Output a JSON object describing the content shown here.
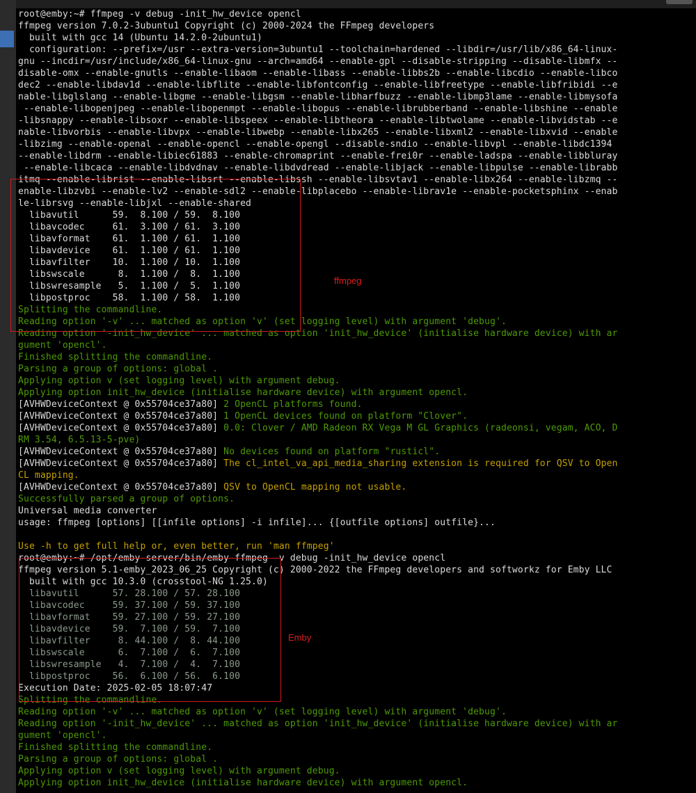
{
  "lines": [
    {
      "c": "w",
      "t": "root@emby:~# ffmpeg -v debug -init_hw_device opencl"
    },
    {
      "c": "w",
      "t": "ffmpeg version 7.0.2-3ubuntu1 Copyright (c) 2000-2024 the FFmpeg developers"
    },
    {
      "c": "w",
      "t": "  built with gcc 14 (Ubuntu 14.2.0-2ubuntu1)"
    },
    {
      "c": "w",
      "t": "  configuration: --prefix=/usr --extra-version=3ubuntu1 --toolchain=hardened --libdir=/usr/lib/x86_64-linux-"
    },
    {
      "c": "w",
      "t": "gnu --incdir=/usr/include/x86_64-linux-gnu --arch=amd64 --enable-gpl --disable-stripping --disable-libmfx --"
    },
    {
      "c": "w",
      "t": "disable-omx --enable-gnutls --enable-libaom --enable-libass --enable-libbs2b --enable-libcdio --enable-libco"
    },
    {
      "c": "w",
      "t": "dec2 --enable-libdav1d --enable-libflite --enable-libfontconfig --enable-libfreetype --enable-libfribidi --e"
    },
    {
      "c": "w",
      "t": "nable-libglslang --enable-libgme --enable-libgsm --enable-libharfbuzz --enable-libmp3lame --enable-libmysofa"
    },
    {
      "c": "w",
      "t": " --enable-libopenjpeg --enable-libopenmpt --enable-libopus --enable-librubberband --enable-libshine --enable"
    },
    {
      "c": "w",
      "t": "-libsnappy --enable-libsoxr --enable-libspeex --enable-libtheora --enable-libtwolame --enable-libvidstab --e"
    },
    {
      "c": "w",
      "t": "nable-libvorbis --enable-libvpx --enable-libwebp --enable-libx265 --enable-libxml2 --enable-libxvid --enable"
    },
    {
      "c": "w",
      "t": "-libzimg --enable-openal --enable-opencl --enable-opengl --disable-sndio --enable-libvpl --enable-libdc1394"
    },
    {
      "c": "w",
      "t": "--enable-libdrm --enable-libiec61883 --enable-chromaprint --enable-frei0r --enable-ladspa --enable-libbluray"
    },
    {
      "c": "w",
      "t": " --enable-libcaca --enable-libdvdnav --enable-libdvdread --enable-libjack --enable-libpulse --enable-librabb"
    },
    {
      "c": "w",
      "t": "itmq --enable-librist --enable-libsrt --enable-libssh --enable-libsvtav1 --enable-libx264 --enable-libzmq --"
    },
    {
      "c": "w",
      "t": "enable-libzvbi --enable-lv2 --enable-sdl2 --enable-libplacebo --enable-librav1e --enable-pocketsphinx --enab"
    },
    {
      "c": "w",
      "t": "le-librsvg --enable-libjxl --enable-shared"
    },
    {
      "c": "w",
      "t": "  libavutil      59.  8.100 / 59.  8.100"
    },
    {
      "c": "w",
      "t": "  libavcodec     61.  3.100 / 61.  3.100"
    },
    {
      "c": "w",
      "t": "  libavformat    61.  1.100 / 61.  1.100"
    },
    {
      "c": "w",
      "t": "  libavdevice    61.  1.100 / 61.  1.100"
    },
    {
      "c": "w",
      "t": "  libavfilter    10.  1.100 / 10.  1.100"
    },
    {
      "c": "w",
      "t": "  libswscale      8.  1.100 /  8.  1.100"
    },
    {
      "c": "w",
      "t": "  libswresample   5.  1.100 /  5.  1.100"
    },
    {
      "c": "w",
      "t": "  libpostproc    58.  1.100 / 58.  1.100"
    },
    {
      "c": "g",
      "t": "Splitting the commandline."
    },
    {
      "c": "g",
      "t": "Reading option '-v' ... matched as option 'v' (set logging level) with argument 'debug'."
    },
    {
      "c": "g",
      "t": "Reading option '-init_hw_device' ... matched as option 'init_hw_device' (initialise hardware device) with ar"
    },
    {
      "c": "g",
      "t": "gument 'opencl'."
    },
    {
      "c": "g",
      "t": "Finished splitting the commandline."
    },
    {
      "c": "g",
      "t": "Parsing a group of options: global ."
    },
    {
      "c": "g",
      "t": "Applying option v (set logging level) with argument debug."
    },
    {
      "c": "g",
      "t": "Applying option init_hw_device (initialise hardware device) with argument opencl."
    },
    {
      "c": "m",
      "p": "[AVHWDeviceContext @ 0x55704ce37a80] ",
      "r": "2 OpenCL platforms found.",
      "rc": "g"
    },
    {
      "c": "m",
      "p": "[AVHWDeviceContext @ 0x55704ce37a80] ",
      "r": "1 OpenCL devices found on platform \"Clover\".",
      "rc": "g"
    },
    {
      "c": "m",
      "p": "[AVHWDeviceContext @ 0x55704ce37a80] ",
      "r": "0.0: Clover / AMD Radeon RX Vega M GL Graphics (radeonsi, vegam, ACO, D",
      "rc": "g"
    },
    {
      "c": "g",
      "t": "RM 3.54, 6.5.13-5-pve)"
    },
    {
      "c": "m",
      "p": "[AVHWDeviceContext @ 0x55704ce37a80] ",
      "r": "No devices found on platform \"rusticl\".",
      "rc": "g"
    },
    {
      "c": "m",
      "p": "[AVHWDeviceContext @ 0x55704ce37a80] ",
      "r": "The cl_intel_va_api_media_sharing extension is required for QSV to Open",
      "rc": "y"
    },
    {
      "c": "y",
      "t": "CL mapping."
    },
    {
      "c": "m",
      "p": "[AVHWDeviceContext @ 0x55704ce37a80] ",
      "r": "QSV to OpenCL mapping not usable.",
      "rc": "y"
    },
    {
      "c": "g",
      "t": "Successfully parsed a group of options."
    },
    {
      "c": "w",
      "t": "Universal media converter"
    },
    {
      "c": "w",
      "t": "usage: ffmpeg [options] [[infile options] -i infile]... {[outfile options] outfile}..."
    },
    {
      "c": "w",
      "t": ""
    },
    {
      "c": "y",
      "t": "Use -h to get full help or, even better, run 'man ffmpeg'"
    },
    {
      "c": "w",
      "t": "root@emby:~# /opt/emby-server/bin/emby-ffmpeg -v debug -init_hw_device opencl"
    },
    {
      "c": "w",
      "t": "ffmpeg version 5.1-emby_2023_06_25 Copyright (c) 2000-2022 the FFmpeg developers and softworkz for Emby LLC"
    },
    {
      "c": "w",
      "t": "  built with gcc 10.3.0 (crosstool-NG 1.25.0)"
    },
    {
      "c": "lib2",
      "t": "  libavutil      57. 28.100 / 57. 28.100"
    },
    {
      "c": "lib2",
      "t": "  libavcodec     59. 37.100 / 59. 37.100"
    },
    {
      "c": "lib2",
      "t": "  libavformat    59. 27.100 / 59. 27.100"
    },
    {
      "c": "lib2",
      "t": "  libavdevice    59.  7.100 / 59.  7.100"
    },
    {
      "c": "lib2",
      "t": "  libavfilter     8. 44.100 /  8. 44.100"
    },
    {
      "c": "lib2",
      "t": "  libswscale      6.  7.100 /  6.  7.100"
    },
    {
      "c": "lib2",
      "t": "  libswresample   4.  7.100 /  4.  7.100"
    },
    {
      "c": "lib2",
      "t": "  libpostproc    56.  6.100 / 56.  6.100"
    },
    {
      "c": "w",
      "t": "Execution Date: 2025-02-05 18:07:47"
    },
    {
      "c": "g",
      "t": "Splitting the commandline."
    },
    {
      "c": "g",
      "t": "Reading option '-v' ... matched as option 'v' (set logging level) with argument 'debug'."
    },
    {
      "c": "g",
      "t": "Reading option '-init_hw_device' ... matched as option 'init_hw_device' (initialise hardware device) with ar"
    },
    {
      "c": "g",
      "t": "gument 'opencl'."
    },
    {
      "c": "g",
      "t": "Finished splitting the commandline."
    },
    {
      "c": "g",
      "t": "Parsing a group of options: global ."
    },
    {
      "c": "g",
      "t": "Applying option v (set logging level) with argument debug."
    },
    {
      "c": "g",
      "t": "Applying option init_hw_device (initialise hardware device) with argument opencl."
    }
  ],
  "annotations": [
    {
      "name": "ffmpeg-annotation",
      "label": "ffmpeg"
    },
    {
      "name": "emby-annotation",
      "label": "Emby"
    }
  ],
  "colors": {
    "background": "#000000",
    "text": "#dcdcdc",
    "green": "#4e9a06",
    "yellow": "#c4a000",
    "annotation": "#d11c1c"
  }
}
